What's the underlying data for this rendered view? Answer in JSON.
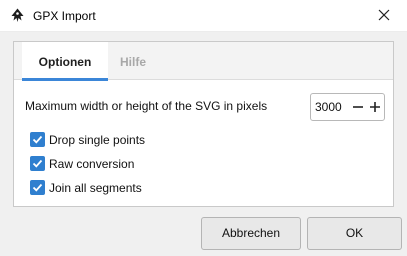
{
  "window": {
    "title": "GPX Import"
  },
  "tabs": [
    {
      "label": "Optionen",
      "active": true
    },
    {
      "label": "Hilfe",
      "active": false
    }
  ],
  "options": {
    "max_size_label": "Maximum width or height of the SVG in pixels",
    "max_size_value": "3000",
    "checkboxes": [
      {
        "label": "Drop single points",
        "checked": true
      },
      {
        "label": "Raw conversion",
        "checked": true
      },
      {
        "label": "Join all segments",
        "checked": true
      }
    ]
  },
  "buttons": {
    "cancel": "Abbrechen",
    "ok": "OK"
  },
  "colors": {
    "accent": "#2f7fcf",
    "tab_underline": "#3b86d8"
  },
  "icons": {
    "app": "inkscape-icon",
    "close": "close-icon",
    "minus": "minus-icon",
    "plus": "plus-icon",
    "check": "checkmark-icon"
  }
}
